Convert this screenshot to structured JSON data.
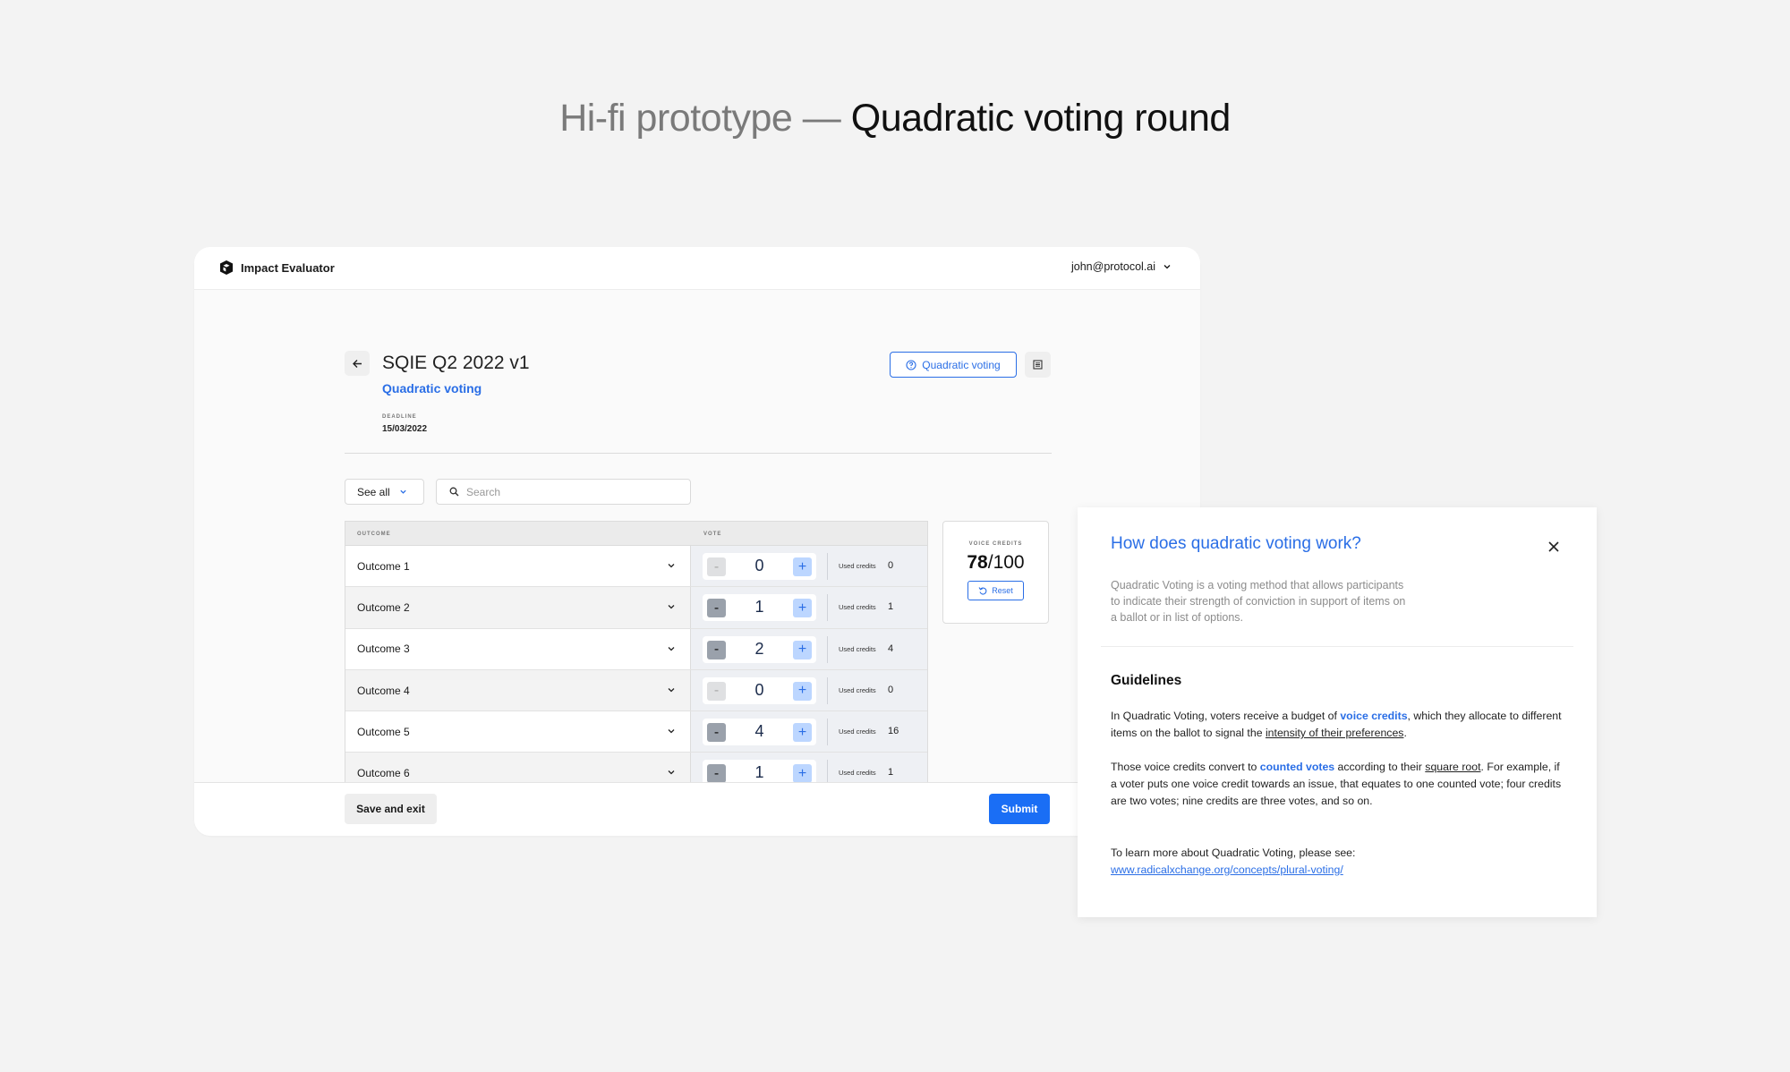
{
  "heading": {
    "muted": "Hi-fi prototype — ",
    "strong": "Quadratic voting round"
  },
  "app": {
    "brand": "Impact Evaluator",
    "user_email": "john@protocol.ai",
    "round_title": "SQIE Q2 2022 v1",
    "round_type": "Quadratic voting",
    "deadline_label": "DEADLINE",
    "deadline_value": "15/03/2022",
    "help_button_label": "Quadratic voting",
    "filter_value": "See all",
    "search_placeholder": "Search",
    "table": {
      "col_outcome": "OUTCOME",
      "col_vote": "VOTE",
      "used_label": "Used credits",
      "rows": [
        {
          "name": "Outcome 1",
          "votes": "0",
          "used": "0"
        },
        {
          "name": "Outcome 2",
          "votes": "1",
          "used": "1"
        },
        {
          "name": "Outcome 3",
          "votes": "2",
          "used": "4"
        },
        {
          "name": "Outcome 4",
          "votes": "0",
          "used": "0"
        },
        {
          "name": "Outcome 5",
          "votes": "4",
          "used": "16"
        },
        {
          "name": "Outcome 6",
          "votes": "1",
          "used": "1"
        }
      ]
    },
    "credits": {
      "label": "VOICE CREDITS",
      "used": "78",
      "total": "/100",
      "reset_label": "Reset"
    },
    "footer": {
      "save_label": "Save and exit",
      "submit_label": "Submit"
    },
    "colors": {
      "accent": "#2a6ee6",
      "submit": "#1a6ef5"
    }
  },
  "help": {
    "title": "How does quadratic voting work?",
    "intro": "Quadratic Voting is a voting method that allows participants to indicate their strength of conviction in support of items on a ballot or in list of options.",
    "guidelines_heading": "Guidelines",
    "p1": {
      "a": "In Quadratic Voting, voters receive a budget of ",
      "b": "voice credits",
      "c": ", which they allocate to different items on the ballot to signal the ",
      "d": "intensity of their preferences",
      "e": "."
    },
    "p2": {
      "a": "Those voice credits convert to ",
      "b": "counted votes",
      "c": " according to their ",
      "d": "square root",
      "e": ". For example, if a voter puts one voice credit towards an issue, that equates to one counted vote; four credits are two votes; nine credits are three votes, and so on."
    },
    "p3": {
      "a": "To learn more about Quadratic Voting, please see:",
      "link": "www.radicalxchange.org/concepts/plural-voting/"
    }
  }
}
